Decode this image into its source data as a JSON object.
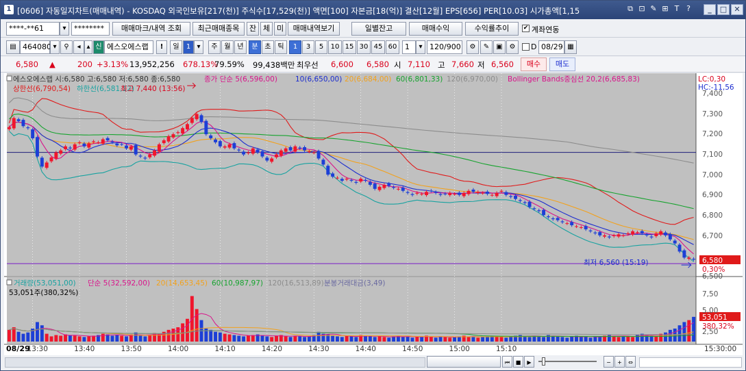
{
  "titlebar": {
    "window_id": "1",
    "title": "[0606] 자동일지차트(매매내역) - KOSDAQ 외국인보유[217(천)] 주식수[17,529(천)] 액면[100] 자본금[18(억)] 결산[12월] EPS[656] PER[10.03] 시가총액[1,15",
    "icons": [
      "⧉",
      "⊡",
      "✎",
      "⊞",
      "T",
      "?"
    ]
  },
  "toolbar1": {
    "account": "****-**61",
    "password": "********",
    "btn_trade_mark": "매매마크/내역 조회",
    "btn_recent": "최근매매종목",
    "btn_jan": "잔",
    "btn_che": "체",
    "btn_mi": "미",
    "btn_history": "매매내역보기",
    "btn_daily_balance": "일별잔고",
    "btn_profit": "매매수익",
    "btn_profit_trend": "수익률추이",
    "chk_link_label": "계좌연동"
  },
  "toolbar2": {
    "code": "464080",
    "stock_name": "에스오에스랩",
    "sin": "신",
    "ex": "!",
    "period_sel": "일",
    "period_num": "1",
    "periods": [
      "주",
      "월",
      "년",
      "분",
      "초",
      "틱"
    ],
    "minutes": [
      "1",
      "3",
      "5",
      "10",
      "15",
      "30",
      "45",
      "60"
    ],
    "mult": "1",
    "count": "120/900",
    "chk_d_label": "D",
    "date": "08/29"
  },
  "price_row": {
    "price": "6,580",
    "arrow": "▲",
    "change": "200",
    "rate": "+3.13%",
    "volume": "13,952,256",
    "vol_ratio": "678.13%",
    "x_ratio": "79.59%",
    "amount": "99,438백만",
    "best_label": "최우선",
    "ask": "6,600",
    "bid": "6,580",
    "open_label": "시",
    "open": "7,110",
    "high_label": "고",
    "high": "7,660",
    "low_label": "저",
    "low": "6,560",
    "buy": "매수",
    "sell": "매도"
  },
  "legend": {
    "ohlc": "에스오에스랩 시:6,580 고:6,580 저:6,580 종:6,580",
    "ma_close": "종가 단순 5(6,596,00)",
    "ma10": "10(6,650,00)",
    "ma20": "20(6,684,00)",
    "ma60": "60(6,801,33)",
    "ma120": "120(6,970,00)",
    "bollinger": "Bollinger Bands중심선 20,2(6,685,83)",
    "upper": "상한선(6,790,54)",
    "lower": "하한선(6,581,12)",
    "high_mark": "최고 7,440 (13:56)",
    "low_mark": "최저 6,560 (15:19)",
    "lc": "LC:0,30",
    "hc": "HC:-11,56",
    "cur_price": "6,580",
    "cur_pct": "0,30%"
  },
  "vol_legend": {
    "vol": "거래량(53,051,00)",
    "ma5": "단순 5(32,592,00)",
    "ma20": "20(14,653,45)",
    "ma60": "60(10,987,97)",
    "ma120": "120(16,513,89)",
    "amount": "분봉거래대금(3,49)",
    "cur": "53,051주(380,32%)",
    "cur_box": "53,051",
    "cur_pct": "380,32%"
  },
  "yticks": [
    "7,400",
    "7,300",
    "7,200",
    "7,100",
    "7,000",
    "6,900",
    "6,800",
    "6,700",
    "6,600",
    "6,500"
  ],
  "vticks": [
    "7,50",
    "5,00",
    "2,50"
  ],
  "xaxis": {
    "date": "08/29",
    "labels": [
      "13:30",
      "13:40",
      "13:50",
      "14:00",
      "14:10",
      "14:20",
      "14:30",
      "14:40",
      "14:50",
      "15:00",
      "15:10"
    ],
    "end_time": "15:30:00"
  },
  "colors": {
    "up": "#f0162c",
    "down": "#1d3fd6",
    "ma5": "#d9148b",
    "ma10": "#1b2ccf",
    "ma20": "#f2a11c",
    "ma60": "#16a32e",
    "ma120": "#8c8c8c",
    "bb": "#e01a1a",
    "bbl": "#17a2a0"
  },
  "chart_data": {
    "type": "candlestick",
    "interval": "1 minute",
    "start_time": "13:25",
    "close": [
      7235,
      7280,
      7265,
      7240,
      7230,
      7180,
      7090,
      7040,
      7060,
      7085,
      7110,
      7120,
      7140,
      7130,
      7150,
      7160,
      7140,
      7155,
      7165,
      7160,
      7175,
      7170,
      7160,
      7145,
      7150,
      7130,
      7140,
      7100,
      7090,
      7080,
      7100,
      7120,
      7150,
      7170,
      7190,
      7200,
      7210,
      7230,
      7250,
      7280,
      7300,
      7260,
      7200,
      7180,
      7160,
      7140,
      7140,
      7150,
      7130,
      7120,
      7100,
      7110,
      7130,
      7110,
      7090,
      7070,
      7080,
      7100,
      7120,
      7130,
      7120,
      7140,
      7130,
      7120,
      7115,
      7110,
      7080,
      7050,
      7000,
      6990,
      6985,
      6970,
      6980,
      6970,
      6960,
      6980,
      6970,
      6950,
      6930,
      6940,
      6950,
      6945,
      6935,
      6930,
      6920,
      6910,
      6900,
      6910,
      6905,
      6915,
      6920,
      6910,
      6900,
      6905,
      6910,
      6905,
      6900,
      6910,
      6920,
      6915,
      6915,
      6910,
      6905,
      6900,
      6910,
      6920,
      6900,
      6890,
      6880,
      6870,
      6860,
      6840,
      6830,
      6820,
      6800,
      6790,
      6780,
      6775,
      6765,
      6760,
      6750,
      6745,
      6740,
      6730,
      6720,
      6710,
      6700,
      6700,
      6690,
      6700,
      6705,
      6700,
      6710,
      6720,
      6715,
      6710,
      6700,
      6690,
      6710,
      6720,
      6700,
      6680,
      6660,
      6620,
      6590,
      6590,
      6580
    ],
    "volume": [
      18,
      22,
      15,
      12,
      14,
      20,
      30,
      25,
      12,
      8,
      10,
      9,
      11,
      10,
      9,
      8,
      7,
      8,
      9,
      10,
      12,
      11,
      9,
      10,
      9,
      8,
      11,
      14,
      9,
      8,
      10,
      13,
      12,
      15,
      18,
      20,
      22,
      28,
      35,
      70,
      50,
      33,
      20,
      18,
      15,
      14,
      12,
      11,
      10,
      9,
      8,
      9,
      10,
      11,
      9,
      8,
      7,
      9,
      10,
      8,
      7,
      9,
      8,
      7,
      8,
      10,
      15,
      12,
      11,
      9,
      8,
      7,
      9,
      8,
      7,
      10,
      8,
      9,
      7,
      8,
      7,
      6,
      8,
      9,
      7,
      8,
      6,
      7,
      8,
      9,
      7,
      6,
      8,
      7,
      6,
      7,
      8,
      9,
      7,
      8,
      6,
      7,
      8,
      9,
      8,
      7,
      6,
      8,
      9,
      10,
      8,
      7,
      9,
      8,
      7,
      10,
      9,
      8,
      7,
      6,
      8,
      9,
      7,
      8,
      6,
      7,
      8,
      9,
      10,
      8,
      7,
      9,
      8,
      7,
      10,
      12,
      11,
      9,
      8,
      12,
      14,
      18,
      20,
      25,
      30,
      33,
      38
    ]
  }
}
